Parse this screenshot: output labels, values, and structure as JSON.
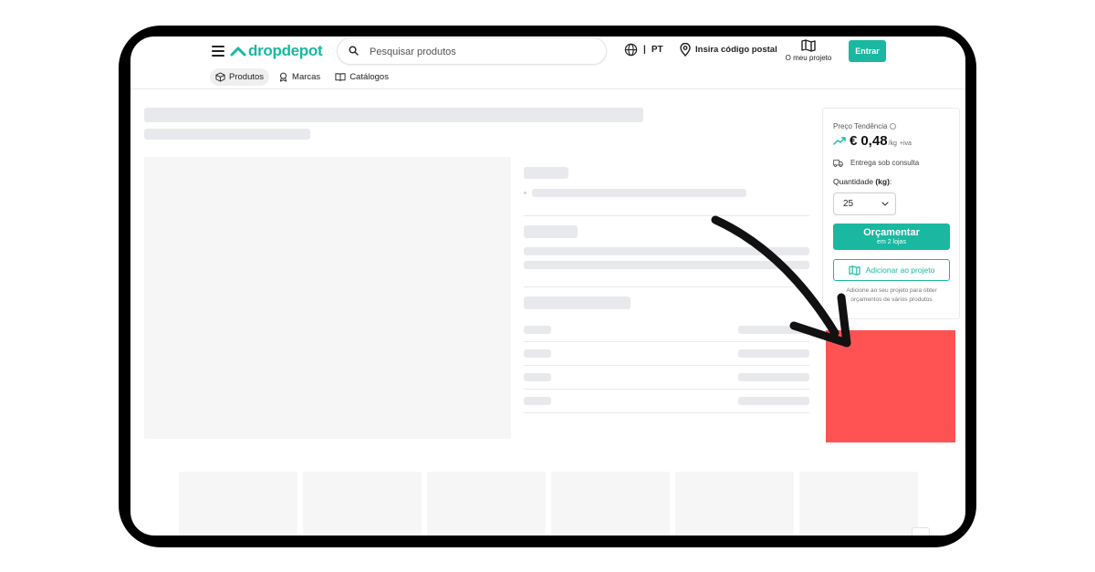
{
  "header": {
    "logo": "dropdepot",
    "search_placeholder": "Pesquisar produtos",
    "language": "PT",
    "language_sep": "|",
    "postal_code": "Insira código postal",
    "project": "O meu projeto",
    "login": "Entrar"
  },
  "nav": {
    "products": "Produtos",
    "brands": "Marcas",
    "catalogs": "Catálogos"
  },
  "price_card": {
    "price_label": "Preço Tendência",
    "currency": "€",
    "price": "0,48",
    "unit": "/kg",
    "vat": "+iva",
    "delivery": "Entrega sob consulta",
    "quantity_label": "Quantidade",
    "quantity_unit": "(kg)",
    "quantity_colon": ":",
    "quantity_value": "25",
    "quote_button": "Orçamentar",
    "quote_sub": "em 2 lojas",
    "add_project": "Adicionar ao projeto",
    "hint": "Adicione ao seu projeto para obter orçamentos de vários produtos"
  },
  "colors": {
    "brand": "#1ab8a0",
    "highlight": "#ff5252",
    "skeleton": "#e8e9ec"
  }
}
